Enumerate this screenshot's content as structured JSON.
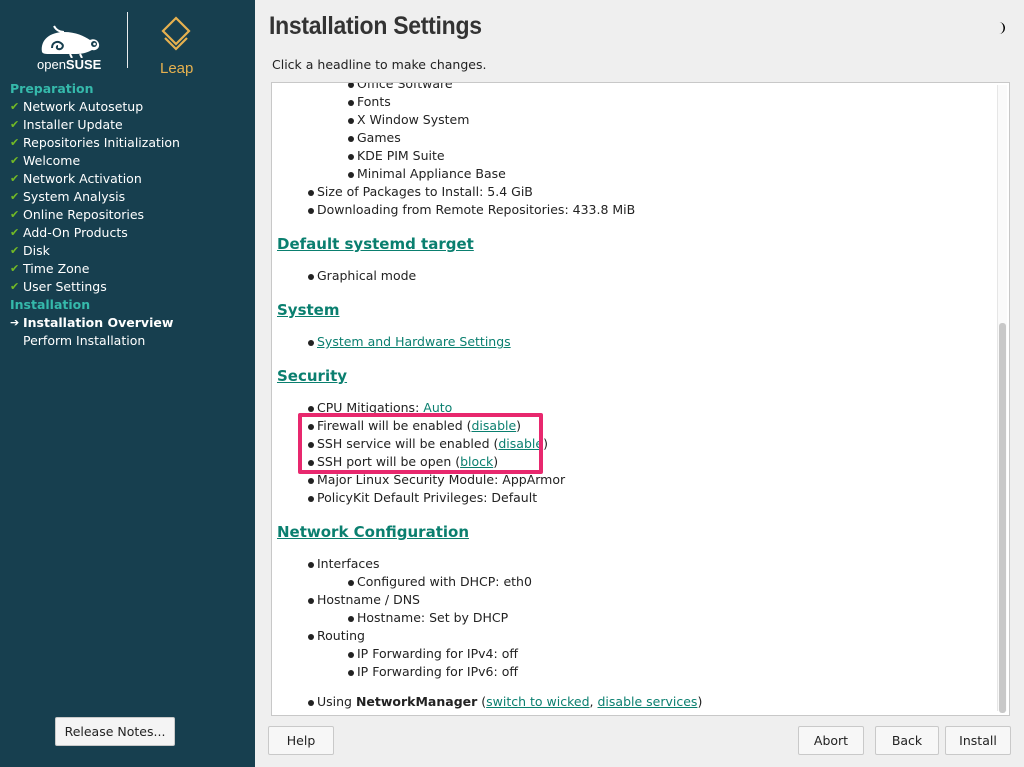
{
  "sidebar": {
    "brand_prefix": "open",
    "brand_name": "SUSE",
    "product": "Leap",
    "sections": [
      {
        "title": "Preparation",
        "steps": [
          "Network Autosetup",
          "Installer Update",
          "Repositories Initialization",
          "Welcome",
          "Network Activation",
          "System Analysis",
          "Online Repositories",
          "Add-On Products",
          "Disk",
          "Time Zone",
          "User Settings"
        ]
      },
      {
        "title": "Installation",
        "current": "Installation Overview",
        "pending": "Perform Installation"
      }
    ],
    "release_notes_label": "Release Notes..."
  },
  "header": {
    "title": "Installation Settings",
    "subtitle": "Click a headline to make changes."
  },
  "content": {
    "software_patterns": [
      "Office Software",
      "Fonts",
      "X Window System",
      "Games",
      "KDE PIM Suite",
      "Minimal Appliance Base"
    ],
    "size_packages": "Size of Packages to Install: 5.4 GiB",
    "downloading": "Downloading from Remote Repositories: 433.8 MiB",
    "systemd_heading": "Default systemd target",
    "systemd_value": "Graphical mode",
    "system_heading": "System",
    "system_link": "System and Hardware Settings",
    "security_heading": "Security",
    "cpu_label": "CPU Mitigations: ",
    "cpu_value": "Auto",
    "firewall_label": "Firewall will be enabled (",
    "firewall_action": "disable",
    "ssh_service_label": "SSH service will be enabled (",
    "ssh_service_action": "disable",
    "ssh_port_label": "SSH port will be open (",
    "ssh_port_action": "block",
    "paren_close": ")",
    "lsm": "Major Linux Security Module: AppArmor",
    "polkit": "PolicyKit Default Privileges: Default",
    "network_heading": "Network Configuration",
    "interfaces": "Interfaces",
    "dhcp": "Configured with DHCP: eth0",
    "hostname_dns": "Hostname / DNS",
    "hostname": "Hostname: Set by DHCP",
    "routing": "Routing",
    "ipv4": "IP Forwarding for IPv4: off",
    "ipv6": "IP Forwarding for IPv6: off",
    "using_prefix": "Using ",
    "using_manager": "NetworkManager",
    "using_open": " (",
    "switch_wicked": "switch to wicked",
    "comma": ", ",
    "disable_services": "disable services",
    "using_close": ")"
  },
  "buttons": {
    "help": "Help",
    "abort": "Abort",
    "back": "Back",
    "install": "Install"
  },
  "colors": {
    "sidebar_bg": "#173f4f",
    "section_title": "#35b9ab",
    "check": "#73ba25",
    "link": "#0a7f6f",
    "highlight": "#e8286e",
    "leap": "#e6b14f"
  }
}
